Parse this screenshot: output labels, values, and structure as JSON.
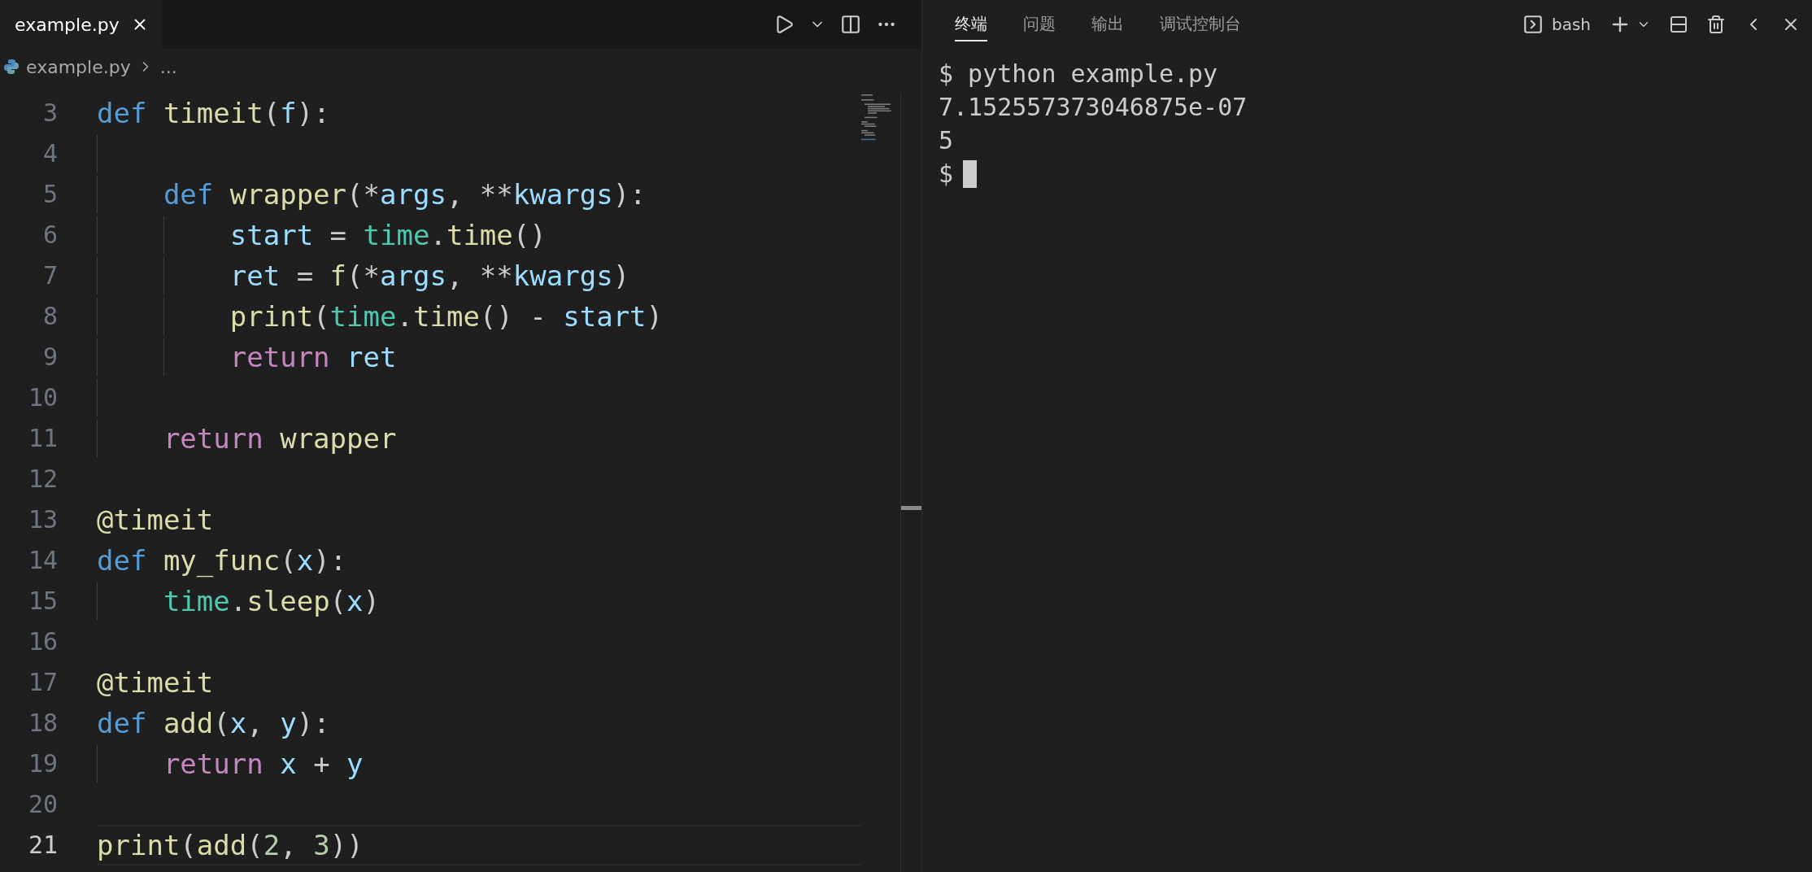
{
  "editor": {
    "tab": {
      "label": "example.py",
      "selected": true
    },
    "breadcrumb": {
      "file": "example.py",
      "more": "..."
    },
    "lines": [
      {
        "number": "3",
        "current": false,
        "tokens": [
          {
            "text": "def ",
            "kind": "keyword"
          },
          {
            "text": "timeit",
            "kind": "function"
          },
          {
            "text": "(",
            "kind": "plain"
          },
          {
            "text": "f",
            "kind": "variable"
          },
          {
            "text": "):",
            "kind": "plain"
          }
        ]
      },
      {
        "number": "4",
        "current": false
      },
      {
        "number": "5",
        "current": false,
        "tokens": [
          {
            "text": "    def ",
            "kind": "keyword"
          },
          {
            "text": "wrapper",
            "kind": "function"
          },
          {
            "text": "(*",
            "kind": "plain"
          },
          {
            "text": "args",
            "kind": "variable"
          },
          {
            "text": ", **",
            "kind": "plain"
          },
          {
            "text": "kwargs",
            "kind": "variable"
          },
          {
            "text": "):",
            "kind": "plain"
          }
        ]
      },
      {
        "number": "6",
        "current": false,
        "tokens": [
          {
            "text": "        start",
            "kind": "variable"
          },
          {
            "text": " = ",
            "kind": "plain"
          },
          {
            "text": "time",
            "kind": "module"
          },
          {
            "text": ".",
            "kind": "plain"
          },
          {
            "text": "time",
            "kind": "function"
          },
          {
            "text": "()",
            "kind": "plain"
          }
        ]
      },
      {
        "number": "7",
        "current": false,
        "tokens": [
          {
            "text": "        ret",
            "kind": "variable"
          },
          {
            "text": " = ",
            "kind": "plain"
          },
          {
            "text": "f",
            "kind": "function"
          },
          {
            "text": "(*",
            "kind": "plain"
          },
          {
            "text": "args",
            "kind": "variable"
          },
          {
            "text": ", **",
            "kind": "plain"
          },
          {
            "text": "kwargs",
            "kind": "variable"
          },
          {
            "text": ")",
            "kind": "plain"
          }
        ]
      },
      {
        "number": "8",
        "current": false,
        "tokens": [
          {
            "text": "        print",
            "kind": "function"
          },
          {
            "text": "(",
            "kind": "plain"
          },
          {
            "text": "time",
            "kind": "module"
          },
          {
            "text": ".",
            "kind": "plain"
          },
          {
            "text": "time",
            "kind": "function"
          },
          {
            "text": "() - ",
            "kind": "plain"
          },
          {
            "text": "start",
            "kind": "variable"
          },
          {
            "text": ")",
            "kind": "plain"
          }
        ]
      },
      {
        "number": "9",
        "current": false,
        "tokens": [
          {
            "text": "        return ",
            "kind": "control"
          },
          {
            "text": "ret",
            "kind": "variable"
          }
        ]
      },
      {
        "number": "10",
        "current": false
      },
      {
        "number": "11",
        "current": false,
        "tokens": [
          {
            "text": "    return ",
            "kind": "control"
          },
          {
            "text": "wrapper",
            "kind": "function"
          }
        ]
      },
      {
        "number": "12",
        "current": false
      },
      {
        "number": "13",
        "current": false,
        "tokens": [
          {
            "text": "@timeit",
            "kind": "function"
          }
        ]
      },
      {
        "number": "14",
        "current": false,
        "tokens": [
          {
            "text": "def ",
            "kind": "keyword"
          },
          {
            "text": "my_func",
            "kind": "function"
          },
          {
            "text": "(",
            "kind": "plain"
          },
          {
            "text": "x",
            "kind": "variable"
          },
          {
            "text": "):",
            "kind": "plain"
          }
        ]
      },
      {
        "number": "15",
        "current": false,
        "tokens": [
          {
            "text": "    time",
            "kind": "module"
          },
          {
            "text": ".",
            "kind": "plain"
          },
          {
            "text": "sleep",
            "kind": "function"
          },
          {
            "text": "(",
            "kind": "plain"
          },
          {
            "text": "x",
            "kind": "variable"
          },
          {
            "text": ")",
            "kind": "plain"
          }
        ]
      },
      {
        "number": "16",
        "current": false
      },
      {
        "number": "17",
        "current": false,
        "tokens": [
          {
            "text": "@timeit",
            "kind": "function"
          }
        ]
      },
      {
        "number": "18",
        "current": false,
        "tokens": [
          {
            "text": "def ",
            "kind": "keyword"
          },
          {
            "text": "add",
            "kind": "function"
          },
          {
            "text": "(",
            "kind": "plain"
          },
          {
            "text": "x",
            "kind": "variable"
          },
          {
            "text": ", ",
            "kind": "plain"
          },
          {
            "text": "y",
            "kind": "variable"
          },
          {
            "text": "):",
            "kind": "plain"
          }
        ]
      },
      {
        "number": "19",
        "current": false,
        "tokens": [
          {
            "text": "    return ",
            "kind": "control"
          },
          {
            "text": "x",
            "kind": "variable"
          },
          {
            "text": " + ",
            "kind": "plain"
          },
          {
            "text": "y",
            "kind": "variable"
          }
        ]
      },
      {
        "number": "20",
        "current": false
      },
      {
        "number": "21",
        "current": true,
        "tokens": [
          {
            "text": "print",
            "kind": "function"
          },
          {
            "text": "(",
            "kind": "plain"
          },
          {
            "text": "add",
            "kind": "function"
          },
          {
            "text": "(",
            "kind": "plain"
          },
          {
            "text": "2",
            "kind": "number"
          },
          {
            "text": ", ",
            "kind": "plain"
          },
          {
            "text": "3",
            "kind": "number"
          },
          {
            "text": "))",
            "kind": "plain"
          }
        ]
      }
    ]
  },
  "panel": {
    "tabs": [
      {
        "label": "终端",
        "selected": true
      },
      {
        "label": "问题",
        "selected": false
      },
      {
        "label": "输出",
        "selected": false
      },
      {
        "label": "调试控制台",
        "selected": false
      }
    ],
    "shell": "bash",
    "terminal_lines": [
      "$ python example.py",
      "7.152557373046875e-07",
      "5",
      "$"
    ]
  }
}
